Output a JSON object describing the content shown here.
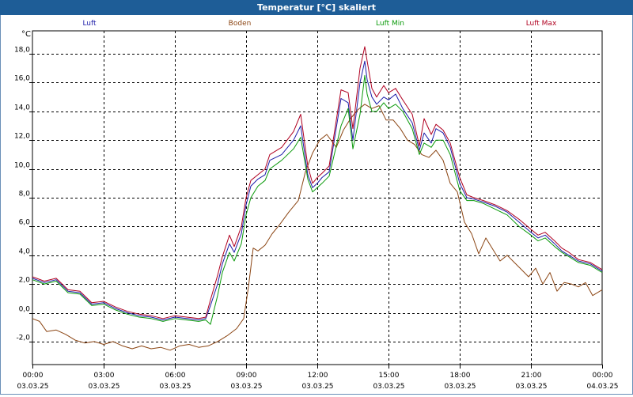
{
  "window": {
    "title": "Temperatur [°C] skaliert"
  },
  "chart_data": {
    "type": "line",
    "title": "Temperatur [°C] skaliert",
    "ylabel": "°C",
    "ylim": [
      -3.6,
      19.6
    ],
    "yticks": [
      -2.0,
      0.0,
      2.0,
      4.0,
      6.0,
      8.0,
      10.0,
      12.0,
      14.0,
      16.0,
      18.0
    ],
    "ytick_labels": [
      "-2,0",
      "0,0",
      "2,0",
      "4,0",
      "6,0",
      "8,0",
      "10,0",
      "12,0",
      "14,0",
      "16,0",
      "18,0"
    ],
    "xlim": [
      0,
      24
    ],
    "xticks": [
      {
        "time": "00:00",
        "date": "03.03.25"
      },
      {
        "time": "03:00",
        "date": "03.03.25"
      },
      {
        "time": "06:00",
        "date": "03.03.25"
      },
      {
        "time": "09:00",
        "date": "03.03.25"
      },
      {
        "time": "12:00",
        "date": "03.03.25"
      },
      {
        "time": "15:00",
        "date": "03.03.25"
      },
      {
        "time": "18:00",
        "date": "03.03.25"
      },
      {
        "time": "21:00",
        "date": "03.03.25"
      },
      {
        "time": "00:00",
        "date": "04.03.25"
      }
    ],
    "grid": true,
    "legend_position": "top",
    "series": [
      {
        "name": "Luft",
        "color": "#1c1ca8",
        "x": [
          0,
          0.5,
          1,
          1.5,
          2,
          2.5,
          3,
          3.5,
          4,
          4.5,
          5,
          5.5,
          6,
          6.5,
          7,
          7.3,
          7.5,
          7.8,
          8,
          8.3,
          8.5,
          8.8,
          9,
          9.2,
          9.5,
          9.8,
          10,
          10.5,
          11,
          11.3,
          11.6,
          11.8,
          12,
          12.2,
          12.5,
          13,
          13.3,
          13.5,
          13.8,
          14,
          14.1,
          14.3,
          14.5,
          14.8,
          15,
          15.3,
          15.6,
          16,
          16.3,
          16.5,
          16.8,
          17,
          17.3,
          17.6,
          18,
          18.3,
          18.6,
          19,
          19.5,
          20,
          20.5,
          21,
          21.3,
          21.6,
          22,
          22.3,
          22.6,
          23,
          23.5,
          24
        ],
        "y": [
          2.4,
          2.1,
          2.3,
          1.5,
          1.4,
          0.6,
          0.7,
          0.3,
          0.0,
          -0.2,
          -0.3,
          -0.5,
          -0.3,
          -0.4,
          -0.5,
          -0.4,
          0.5,
          2.0,
          3.4,
          4.8,
          4.2,
          5.5,
          7.5,
          8.8,
          9.3,
          9.6,
          10.6,
          11.0,
          12.0,
          13.0,
          9.6,
          8.7,
          9.0,
          9.4,
          9.8,
          14.9,
          14.6,
          12.0,
          16.0,
          17.5,
          16.2,
          15.0,
          14.5,
          15.0,
          14.8,
          15.2,
          14.2,
          13.2,
          11.3,
          12.5,
          11.8,
          12.8,
          12.5,
          11.5,
          9.0,
          8.0,
          7.9,
          7.7,
          7.4,
          7.0,
          6.3,
          5.6,
          5.2,
          5.4,
          4.8,
          4.3,
          4.0,
          3.6,
          3.4,
          2.9
        ]
      },
      {
        "name": "Boden",
        "color": "#8b4513",
        "x": [
          0,
          0.3,
          0.6,
          1,
          1.4,
          1.8,
          2.2,
          2.6,
          3,
          3.4,
          3.8,
          4.2,
          4.6,
          5,
          5.4,
          5.8,
          6.2,
          6.6,
          7,
          7.4,
          7.8,
          8.2,
          8.6,
          8.9,
          9.1,
          9.3,
          9.5,
          9.8,
          10.1,
          10.4,
          10.8,
          11.2,
          11.5,
          11.8,
          12.1,
          12.4,
          12.8,
          13.1,
          13.4,
          13.7,
          14,
          14.3,
          14.6,
          14.9,
          15.2,
          15.5,
          15.8,
          16.1,
          16.4,
          16.7,
          17,
          17.3,
          17.6,
          17.9,
          18.2,
          18.5,
          18.8,
          19.1,
          19.4,
          19.7,
          20,
          20.3,
          20.6,
          20.9,
          21.2,
          21.5,
          21.8,
          22.1,
          22.4,
          22.7,
          23,
          23.3,
          23.6,
          24
        ],
        "y": [
          -0.4,
          -0.6,
          -1.3,
          -1.2,
          -1.5,
          -1.9,
          -2.1,
          -2.0,
          -2.2,
          -2.0,
          -2.3,
          -2.5,
          -2.3,
          -2.5,
          -2.4,
          -2.6,
          -2.3,
          -2.2,
          -2.4,
          -2.3,
          -2.0,
          -1.6,
          -1.1,
          -0.4,
          1.8,
          4.5,
          4.3,
          4.7,
          5.5,
          6.1,
          7.0,
          7.8,
          9.8,
          11.1,
          12.0,
          12.4,
          11.5,
          12.7,
          13.5,
          14.1,
          14.5,
          14.2,
          14.4,
          13.4,
          13.4,
          12.8,
          12.0,
          11.7,
          11.0,
          10.8,
          11.3,
          10.6,
          9.0,
          8.4,
          6.3,
          5.5,
          4.1,
          5.2,
          4.4,
          3.6,
          4.0,
          3.5,
          3.0,
          2.5,
          3.1,
          2.0,
          2.8,
          1.5,
          2.1,
          2.0,
          1.8,
          2.1,
          1.2,
          1.6
        ]
      },
      {
        "name": "Luft Min",
        "color": "#0a9a0a",
        "x": [
          0,
          0.5,
          1,
          1.5,
          2,
          2.5,
          3,
          3.5,
          4,
          4.5,
          5,
          5.5,
          6,
          6.5,
          7,
          7.3,
          7.5,
          7.8,
          8,
          8.3,
          8.5,
          8.8,
          9,
          9.2,
          9.5,
          9.8,
          10,
          10.5,
          11,
          11.3,
          11.6,
          11.8,
          12,
          12.2,
          12.5,
          13,
          13.3,
          13.5,
          13.8,
          14,
          14.1,
          14.3,
          14.5,
          14.8,
          15,
          15.3,
          15.6,
          16,
          16.3,
          16.5,
          16.8,
          17,
          17.3,
          17.6,
          18,
          18.3,
          18.6,
          19,
          19.5,
          20,
          20.5,
          21,
          21.3,
          21.6,
          22,
          22.3,
          22.6,
          23,
          23.5,
          24
        ],
        "y": [
          2.3,
          2.0,
          2.2,
          1.4,
          1.3,
          0.5,
          0.6,
          0.2,
          -0.1,
          -0.3,
          -0.4,
          -0.6,
          -0.4,
          -0.5,
          -0.6,
          -0.5,
          -0.8,
          1.2,
          2.8,
          4.2,
          3.6,
          4.8,
          6.8,
          8.0,
          8.8,
          9.2,
          10.0,
          10.6,
          11.4,
          12.2,
          9.3,
          8.4,
          8.7,
          9.0,
          9.5,
          13.0,
          14.2,
          11.4,
          13.8,
          16.5,
          15.2,
          14.0,
          14.0,
          14.6,
          14.2,
          14.5,
          14.0,
          12.8,
          11.0,
          11.8,
          11.5,
          12.0,
          12.0,
          11.0,
          8.5,
          7.8,
          7.8,
          7.6,
          7.2,
          6.8,
          6.0,
          5.4,
          5.0,
          5.2,
          4.6,
          4.2,
          3.9,
          3.5,
          3.3,
          2.8
        ]
      },
      {
        "name": "Luft Max",
        "color": "#b00020",
        "x": [
          0,
          0.5,
          1,
          1.5,
          2,
          2.5,
          3,
          3.5,
          4,
          4.5,
          5,
          5.5,
          6,
          6.5,
          7,
          7.3,
          7.5,
          7.8,
          8,
          8.3,
          8.5,
          8.8,
          9,
          9.2,
          9.5,
          9.8,
          10,
          10.5,
          11,
          11.3,
          11.6,
          11.8,
          12,
          12.2,
          12.5,
          13,
          13.3,
          13.5,
          13.8,
          14,
          14.1,
          14.3,
          14.5,
          14.8,
          15,
          15.3,
          15.6,
          16,
          16.3,
          16.5,
          16.8,
          17,
          17.3,
          17.6,
          18,
          18.3,
          18.6,
          19,
          19.5,
          20,
          20.5,
          21,
          21.3,
          21.6,
          22,
          22.3,
          22.6,
          23,
          23.5,
          24
        ],
        "y": [
          2.5,
          2.2,
          2.4,
          1.6,
          1.5,
          0.7,
          0.8,
          0.4,
          0.1,
          -0.1,
          -0.2,
          -0.4,
          -0.2,
          -0.3,
          -0.4,
          -0.3,
          0.9,
          2.6,
          3.9,
          5.4,
          4.6,
          6.0,
          8.0,
          9.2,
          9.6,
          10.0,
          11.0,
          11.5,
          12.6,
          13.8,
          10.2,
          9.0,
          9.4,
          9.7,
          10.2,
          15.5,
          15.3,
          12.8,
          17.0,
          18.5,
          17.5,
          15.6,
          15.0,
          15.8,
          15.3,
          15.6,
          14.8,
          13.8,
          11.6,
          13.5,
          12.4,
          13.1,
          12.7,
          11.8,
          9.4,
          8.2,
          8.0,
          7.8,
          7.5,
          7.1,
          6.5,
          5.8,
          5.4,
          5.6,
          5.0,
          4.5,
          4.2,
          3.7,
          3.5,
          3.0
        ]
      }
    ]
  }
}
